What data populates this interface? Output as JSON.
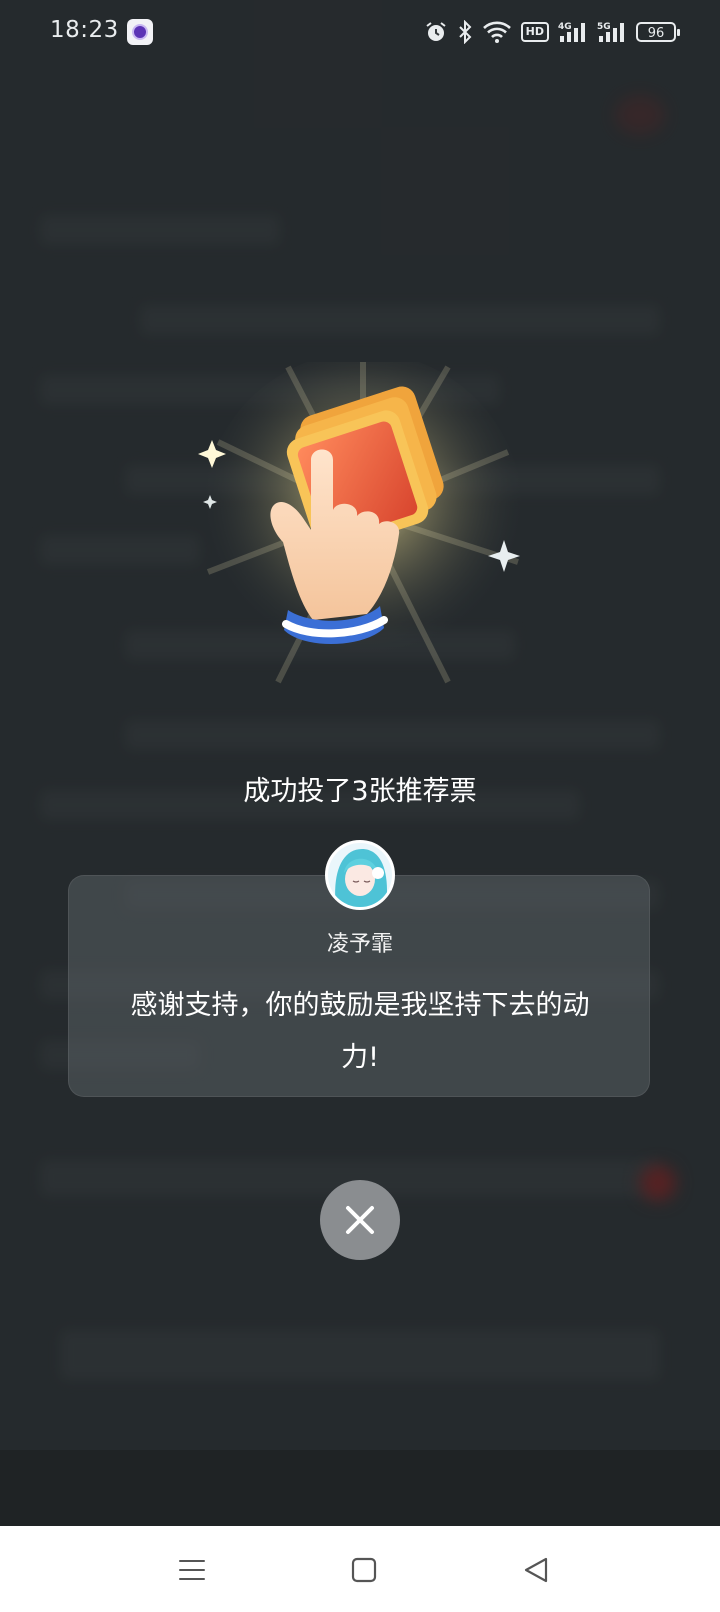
{
  "status_bar": {
    "time": "18:23",
    "battery": "96",
    "icons": [
      "app-notification-icon",
      "alarm-icon",
      "bluetooth-icon",
      "wifi-icon",
      "hd-icon",
      "signal-4g-icon",
      "signal-5g-icon",
      "battery-icon"
    ],
    "hd_label": "HD",
    "net1_label": "4G",
    "net2_label": "5G"
  },
  "dialog": {
    "success_message": "成功投了3张推荐票",
    "author_name": "凌予霏",
    "thanks_message": "感谢支持，你的鼓励是我坚持下去的动力!",
    "close_icon": "close-icon"
  },
  "nav_bar": {
    "icons": [
      "menu-icon",
      "home-icon",
      "back-icon"
    ]
  },
  "colors": {
    "overlay": "#2f3538",
    "card": "#585e62",
    "close_button": "#8a8d90",
    "ticket": "#e85a3c",
    "sleeve": "#3b6fd6"
  }
}
